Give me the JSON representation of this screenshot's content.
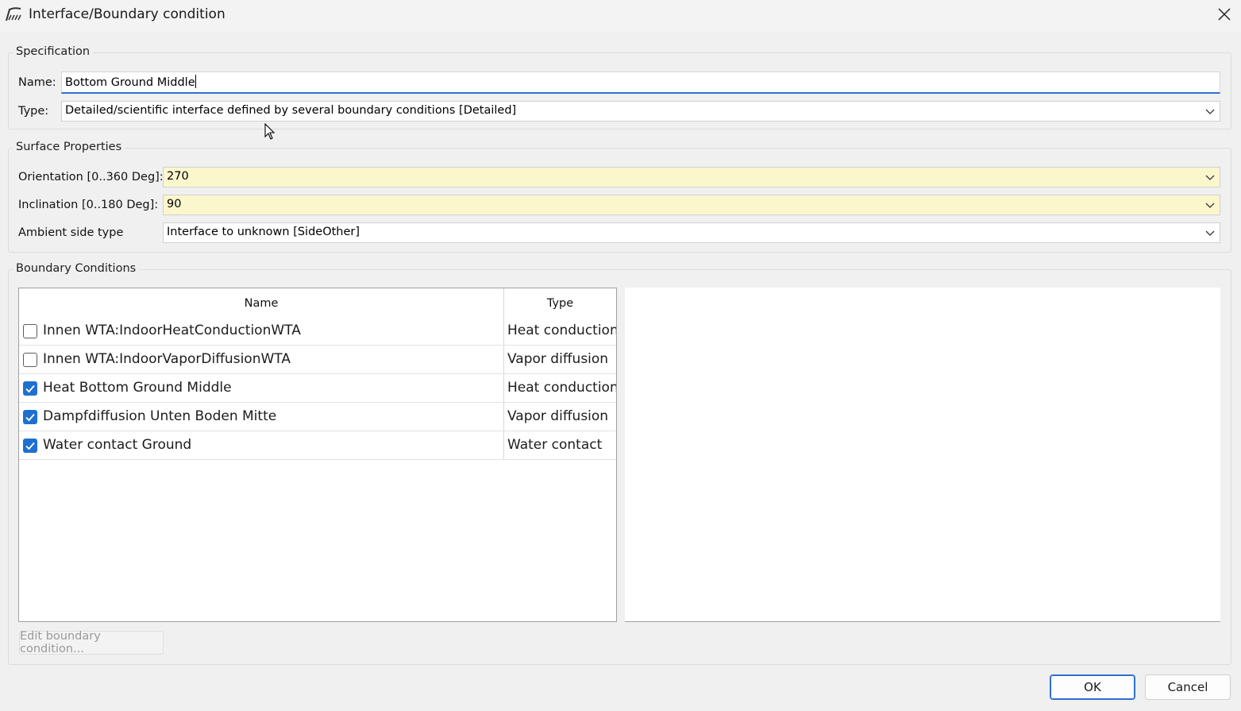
{
  "window": {
    "title": "Interface/Boundary condition",
    "app_icon": "delphin-app-icon",
    "close_icon": "close-icon"
  },
  "specification": {
    "group_title": "Specification",
    "name_label": "Name:",
    "name_value": "Bottom Ground Middle",
    "type_label": "Type:",
    "type_value": "Detailed/scientific interface defined by several boundary conditions [Detailed]"
  },
  "surface": {
    "group_title": "Surface Properties",
    "orientation_label": "Orientation [0..360 Deg]:",
    "orientation_value": "270",
    "inclination_label": "Inclination [0..180 Deg]:",
    "inclination_value": "90",
    "ambient_label": "Ambient side type",
    "ambient_value": "Interface to unknown [SideOther]"
  },
  "boundary": {
    "group_title": "Boundary Conditions",
    "columns": [
      "Name",
      "Type"
    ],
    "rows": [
      {
        "name": "Innen WTA:IndoorHeatConductionWTA",
        "type": "Heat conduction",
        "checked": false
      },
      {
        "name": "Innen WTA:IndoorVaporDiffusionWTA",
        "type": "Vapor diffusion",
        "checked": false
      },
      {
        "name": "Heat Bottom Ground Middle",
        "type": "Heat conduction",
        "checked": true
      },
      {
        "name": "Dampfdiffusion Unten Boden Mitte",
        "type": "Vapor diffusion",
        "checked": true
      },
      {
        "name": "Water contact Ground",
        "type": "Water contact",
        "checked": true
      }
    ],
    "edit_button": "Edit boundary condition..."
  },
  "buttons": {
    "ok": "OK",
    "cancel": "Cancel"
  },
  "colors": {
    "accent": "#1f6fd0",
    "highlight_field": "#fbf7cd"
  }
}
